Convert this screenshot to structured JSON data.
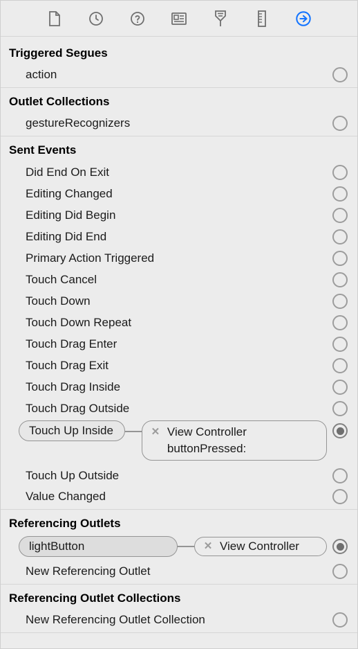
{
  "sections": {
    "triggered_segues": {
      "title": "Triggered Segues",
      "items": [
        {
          "label": "action"
        }
      ]
    },
    "outlet_collections": {
      "title": "Outlet Collections",
      "items": [
        {
          "label": "gestureRecognizers"
        }
      ]
    },
    "sent_events": {
      "title": "Sent Events",
      "items": [
        {
          "label": "Did End On Exit"
        },
        {
          "label": "Editing Changed"
        },
        {
          "label": "Editing Did Begin"
        },
        {
          "label": "Editing Did End"
        },
        {
          "label": "Primary Action Triggered"
        },
        {
          "label": "Touch Cancel"
        },
        {
          "label": "Touch Down"
        },
        {
          "label": "Touch Down Repeat"
        },
        {
          "label": "Touch Drag Enter"
        },
        {
          "label": "Touch Drag Exit"
        },
        {
          "label": "Touch Drag Inside"
        },
        {
          "label": "Touch Drag Outside"
        },
        {
          "label": "Touch Up Outside"
        },
        {
          "label": "Value Changed"
        }
      ],
      "touch_up_inside": {
        "label": "Touch Up Inside",
        "target": "View Controller",
        "action": "buttonPressed:"
      }
    },
    "referencing_outlets": {
      "title": "Referencing Outlets",
      "light_button": {
        "label": "lightButton",
        "target": "View Controller"
      },
      "new_ref": {
        "label": "New Referencing Outlet"
      }
    },
    "referencing_outlet_collections": {
      "title": "Referencing Outlet Collections",
      "new_ref_coll": {
        "label": "New Referencing Outlet Collection"
      }
    }
  }
}
